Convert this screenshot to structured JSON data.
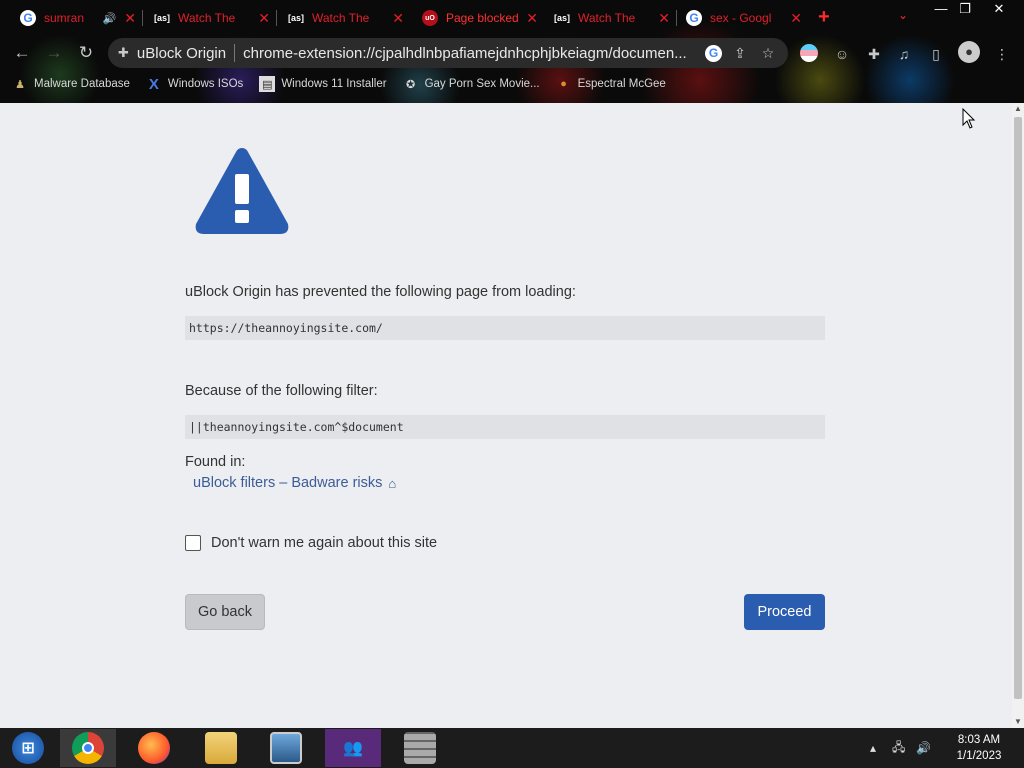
{
  "browser": {
    "tabs": [
      {
        "favicon": "google-icon",
        "title": "sumran",
        "has_speaker": true
      },
      {
        "favicon": "as-icon",
        "title": "Watch The",
        "has_speaker": false
      },
      {
        "favicon": "as-icon",
        "title": "Watch The",
        "has_speaker": false
      },
      {
        "favicon": "ublock-icon",
        "title": "Page blocked",
        "has_speaker": false,
        "active": true
      },
      {
        "favicon": "as-icon",
        "title": "Watch The",
        "has_speaker": false
      },
      {
        "favicon": "google-icon",
        "title": "sex - Googl",
        "has_speaker": false
      }
    ],
    "new_tab_label": "+",
    "tab_search_label": "⌄",
    "window_controls": {
      "minimize": "—",
      "restore": "❐",
      "close": "✕"
    },
    "nav": {
      "back": "←",
      "forward": "→",
      "reload": "↻"
    },
    "omnibox": {
      "origin": "uBlock Origin",
      "url": "chrome-extension://cjpalhdlnbpafiamejdnhcphjbkeiagm/documen..."
    },
    "bookmarks": [
      {
        "icon": "malware-db-icon",
        "label": "Malware Database"
      },
      {
        "icon": "x-icon",
        "label": "Windows ISOs"
      },
      {
        "icon": "installer-icon",
        "label": "Windows 11 Installer"
      },
      {
        "icon": "movie-icon",
        "label": "Gay Porn Sex Movie..."
      },
      {
        "icon": "pumpkin-icon",
        "label": "Espectral McGee"
      }
    ]
  },
  "page": {
    "prevented_message": "uBlock Origin has prevented the following page from loading:",
    "blocked_url": "https://theannoyingsite.com/",
    "filter_message": "Because of the following filter:",
    "filter_rule": "||theannoyingsite.com^$document",
    "found_in_label": "Found in:",
    "filter_list_link": "uBlock filters – Badware risks",
    "dont_warn_label": "Don't warn me again about this site",
    "dont_warn_checked": false,
    "go_back_label": "Go back",
    "proceed_label": "Proceed"
  },
  "taskbar": {
    "apps": [
      "start-orb-icon",
      "chrome-icon",
      "firefox-icon",
      "file-explorer-icon",
      "photo-viewer-icon",
      "users-app-icon",
      "wall-app-icon"
    ],
    "clock_time": "8:03 AM",
    "clock_date": "1/1/2023"
  },
  "colors": {
    "accent_blue": "#2a5db0",
    "warning_icon_blue": "#2a5db0",
    "link_blue": "#3c5c96",
    "tab_text_red": "#e0202a",
    "page_bg": "#eceef1"
  }
}
